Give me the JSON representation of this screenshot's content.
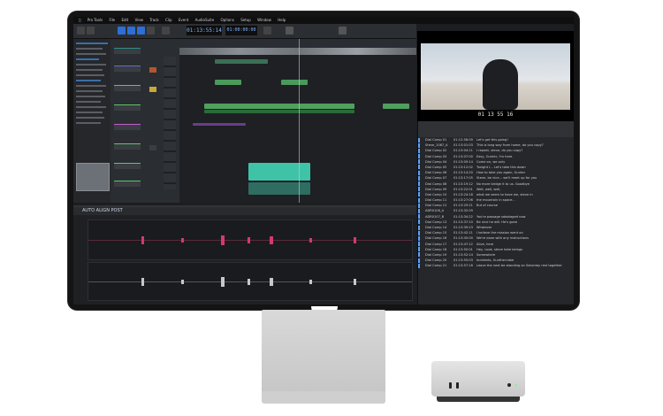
{
  "menubar": {
    "items": [
      "Pro Tools",
      "File",
      "Edit",
      "View",
      "Track",
      "Clip",
      "Event",
      "AudioSuite",
      "Options",
      "Setup",
      "Window",
      "Help"
    ]
  },
  "toolbar": {
    "main_counter": "01:13:55:14",
    "sub_counter": "01:00:00:00"
  },
  "video": {
    "timecode": "01 13 55 16"
  },
  "aar": {
    "title": "AUTO ALIGN POST"
  },
  "list": {
    "rows": [
      {
        "name": "Dial Comp 01",
        "tc": "01:12:58:09",
        "text": "Let's get this going!"
      },
      {
        "name": "Steve_1067_A",
        "tc": "01:13:01:03",
        "text": "This is long way from home, do you copy?"
      },
      {
        "name": "Dial Comp 02",
        "tc": "01:13:04:11",
        "text": "I repeat, steve, do you copy?"
      },
      {
        "name": "Dial Comp 03",
        "tc": "01:13:07:00",
        "text": "Easy, Gunter, I'm here."
      },
      {
        "name": "Dial Comp 04",
        "tc": "01:13:09:14",
        "text": "Come on, we only"
      },
      {
        "name": "Dial Comp 05",
        "tc": "01:13:12:02",
        "text": "Tonight I... Let's take this down"
      },
      {
        "name": "Dial Comp 06",
        "tc": "01:13:14:20",
        "text": "How to take you again, Gunter"
      },
      {
        "name": "Dial Comp 07",
        "tc": "01:13:17:05",
        "text": "Steve, be nice... we'll meet up for you"
      },
      {
        "name": "Dial Comp 08",
        "tc": "01:13:19:12",
        "text": "No more bridge it to us. Goodbye"
      },
      {
        "name": "Dial Comp 09",
        "tc": "01:13:22:01",
        "text": "Well, well, well,"
      },
      {
        "name": "Dial Comp 10",
        "tc": "01:13:24:18",
        "text": "what we seem to have we, steve in"
      },
      {
        "name": "Dial Comp 11",
        "tc": "01:13:27:06",
        "text": "the mountain in space..."
      },
      {
        "name": "Dial Comp 12",
        "tc": "01:13:29:21",
        "text": "But of course"
      },
      {
        "name": "ADR0106_A",
        "tc": "01:13:32:09",
        "text": ""
      },
      {
        "name": "ADR0107_B",
        "tc": "01:13:34:22",
        "text": "You're passage sabotaged now"
      },
      {
        "name": "Dial Comp 13",
        "tc": "01:13:37:10",
        "text": "Be nice he will. He's gone"
      },
      {
        "name": "Dial Comp 14",
        "tc": "01:13:39:23",
        "text": "Whatever"
      },
      {
        "name": "Dial Comp 15",
        "tc": "01:13:42:11",
        "text": "I believe the mission went on"
      },
      {
        "name": "Dial Comp 16",
        "tc": "01:13:45:00",
        "text": "We're done with any instructions"
      },
      {
        "name": "Dial Comp 17",
        "tc": "01:13:47:12",
        "text": "Alive, here"
      },
      {
        "name": "Dial Comp 18",
        "tc": "01:13:50:01",
        "text": "Hey, Look, steve hate beings"
      },
      {
        "name": "Dial Comp 19",
        "tc": "01:13:52:14",
        "text": "Somewhere"
      },
      {
        "name": "Dial Comp 20",
        "tc": "01:13:55:03",
        "text": "Incidents, Gunther-take"
      },
      {
        "name": "Dial Comp 21",
        "tc": "01:13:57:16",
        "text": "Leave the next be standing on Saturday rest together"
      }
    ]
  }
}
